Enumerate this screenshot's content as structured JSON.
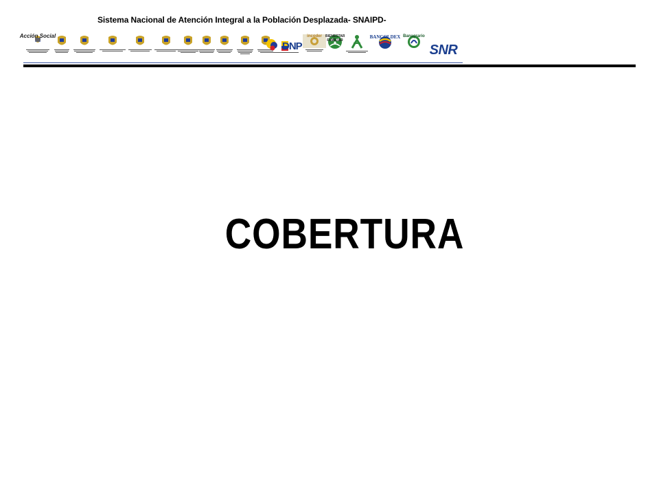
{
  "header": {
    "title": "Sistema Nacional de Atención Integral a la Población Desplazada- SNAIPD-"
  },
  "logos": {
    "accion_social": "Acción Social",
    "dnp": "DNP",
    "incoder": "incoder",
    "bienestar_familiar": "BIENESTAR FAMILIAR",
    "sena": "SENA",
    "bancoldex": "BANCOLDEX",
    "banagrario": "Banagrario",
    "snr": "SNR"
  },
  "main": {
    "title": "COBERTURA"
  },
  "colors": {
    "text": "#000000",
    "rule": "#000000",
    "crest_gold": "#c9a227",
    "dnp_blue": "#1b3f8f",
    "colombia_yellow": "#f4c400",
    "colombia_blue": "#1f3c99",
    "colombia_red": "#d0202a",
    "bienestar_green": "#2e8b3a",
    "snr_blue": "#1b3f8f"
  }
}
